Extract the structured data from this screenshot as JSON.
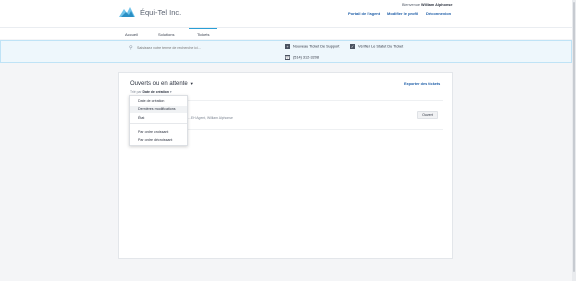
{
  "header": {
    "brand": "Équi-Tel Inc.",
    "welcome_prefix": "Bienvenue",
    "user_name": "William Alphonse",
    "links": [
      "Portail de l'agent",
      "Modifier le profil",
      "Déconnexion"
    ]
  },
  "tabs": [
    "Accueil",
    "Solutions",
    "Tickets"
  ],
  "active_tab": "Tickets",
  "search": {
    "placeholder": "Saisissez votre terme de recherche ici..."
  },
  "actions": {
    "new_ticket": "Nouveau Ticket De Support",
    "check_status": "Vérifier Le Statut Du Ticket",
    "phone": "(514) 312-3208"
  },
  "panel": {
    "title": "Ouverts ou en attente",
    "sort_prefix": "Trié par",
    "sort_value": "Date de création",
    "export_label": "Exporter des tickets"
  },
  "ticket": {
    "meta": "...EH Agent, William Alphonse",
    "status": "Ouvert"
  },
  "sort_menu": {
    "items": [
      "Date de création",
      "Dernières modifications",
      "État"
    ],
    "order_items": [
      "Par ordre croissant",
      "Par ordre décroissant"
    ],
    "highlighted": "Dernières modifications"
  },
  "colors": {
    "link": "#1e5ea8",
    "accent": "#2a9fd6"
  }
}
